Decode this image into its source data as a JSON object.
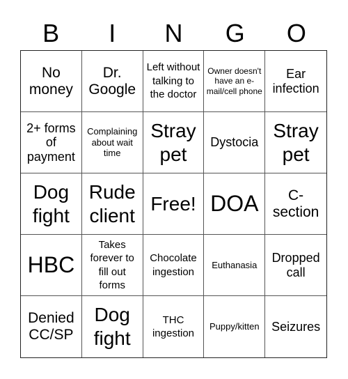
{
  "header": {
    "letters": [
      "B",
      "I",
      "N",
      "G",
      "O"
    ]
  },
  "card": {
    "rows": [
      [
        "No money",
        "Dr. Google",
        "Left without talking to the doctor",
        "Owner doesn't have an e-mail/cell phone",
        "Ear infection"
      ],
      [
        "2+ forms of payment",
        "Complaining about wait time",
        "Stray pet",
        "Dystocia",
        "Stray pet"
      ],
      [
        "Dog fight",
        "Rude client",
        "Free!",
        "DOA",
        "C-section"
      ],
      [
        "HBC",
        "Takes forever to fill out forms",
        "Chocolate ingestion",
        "Euthanasia",
        "Dropped call"
      ],
      [
        "Denied CC/SP",
        "Dog fight",
        "THC ingestion",
        "Puppy/kitten",
        "Seizures"
      ]
    ],
    "free_space": "Free!"
  }
}
